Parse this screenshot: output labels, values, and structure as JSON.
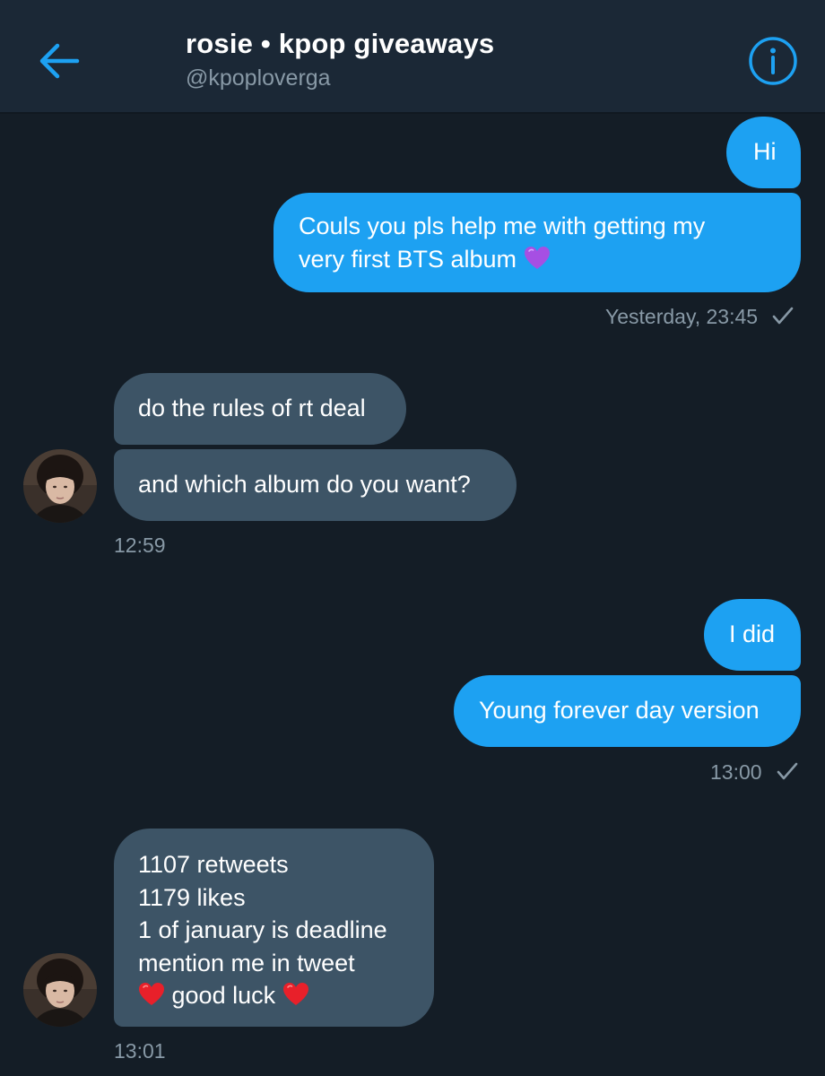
{
  "header": {
    "title": "rosie • kpop giveaways",
    "handle": "@kpoploverga"
  },
  "icons": {
    "back": "back-arrow-icon",
    "info": "info-icon",
    "read_receipt": "checkmark-icon",
    "heart_purple": "purple-heart-emoji",
    "heart_red": "red-heart-emoji"
  },
  "colors": {
    "accent": "#1da1f2",
    "received_bubble": "#3d5466",
    "background": "#141d26",
    "header_bg": "#1b2836",
    "meta_text": "#8899a6"
  },
  "messages": {
    "m1": {
      "text": "Hi"
    },
    "m2": {
      "line1": "Couls you pls help me with getting my",
      "line2": "very first BTS album"
    },
    "t1": {
      "time": "Yesterday, 23:45"
    },
    "m3": {
      "text": "do the rules of rt deal"
    },
    "m4": {
      "text": "and which album do you want?"
    },
    "t2": {
      "time": "12:59"
    },
    "m5": {
      "text": "I did"
    },
    "m6": {
      "text": "Young forever day version"
    },
    "t3": {
      "time": "13:00"
    },
    "m7": {
      "line1": "1107 retweets",
      "line2": "1179 likes",
      "line3": "1 of january is deadline",
      "line4": "mention me in tweet",
      "line5": "good luck"
    },
    "t4": {
      "time": "13:01"
    }
  }
}
